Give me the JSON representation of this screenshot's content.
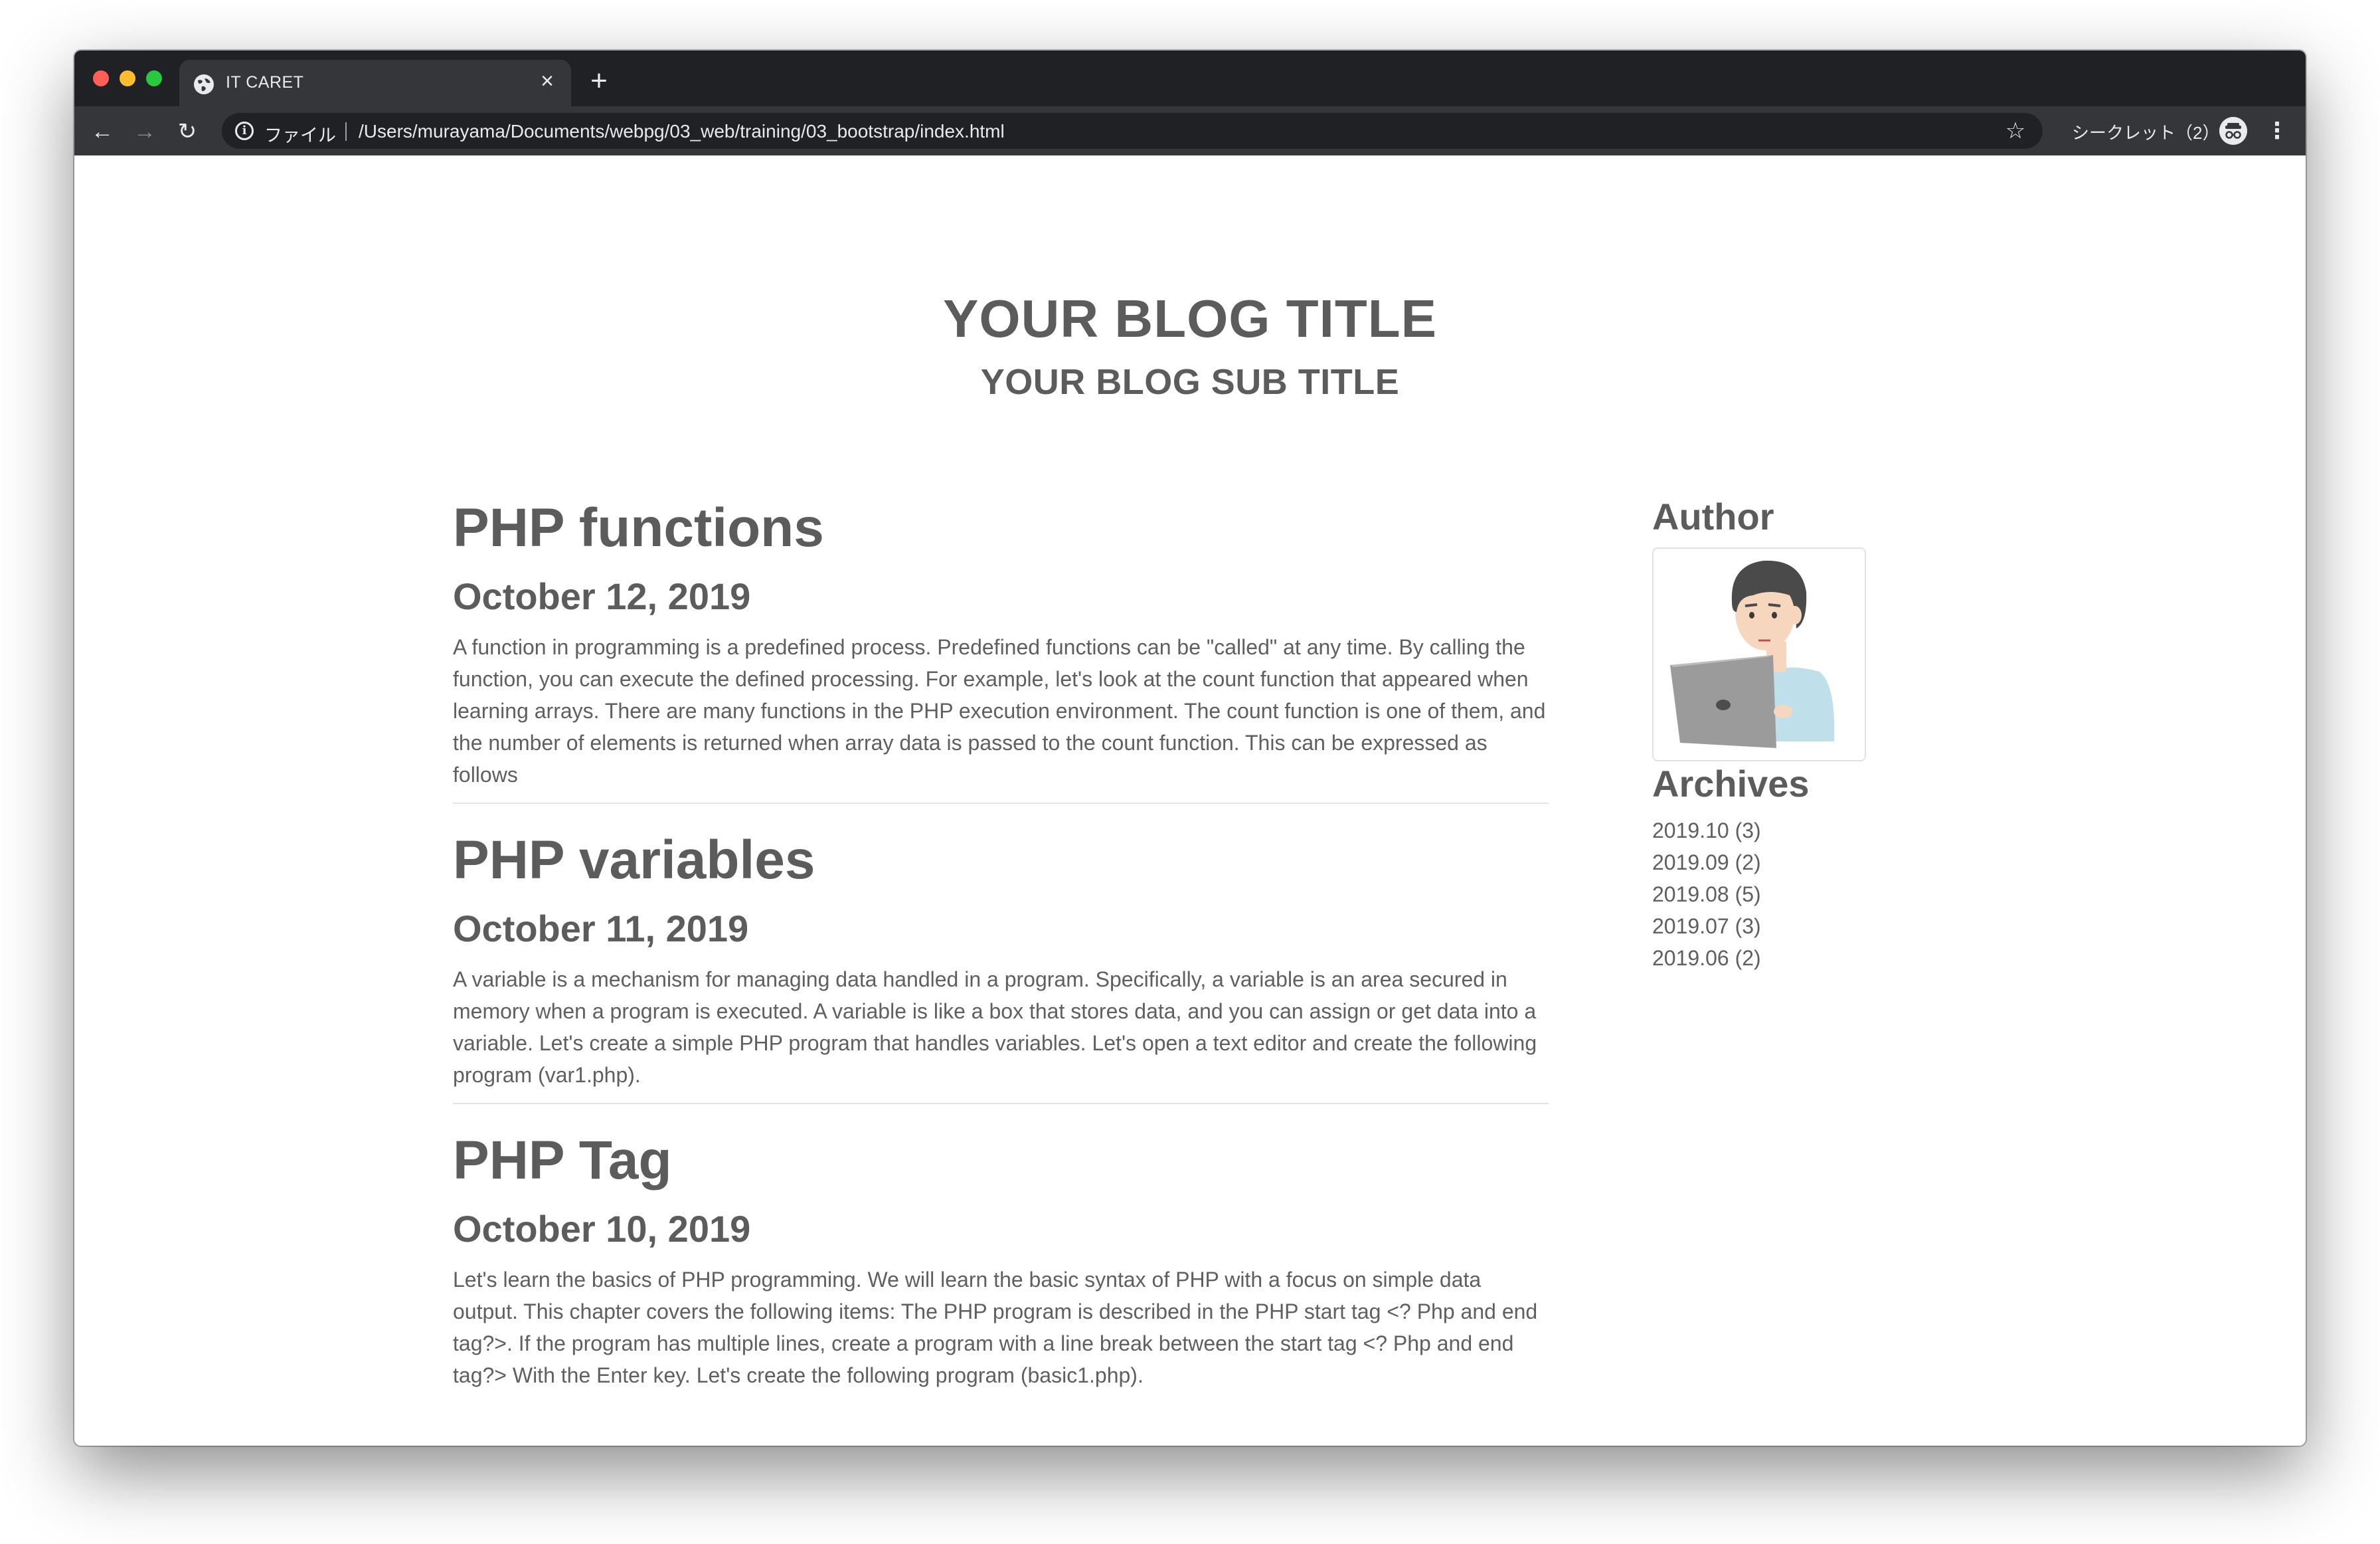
{
  "browser": {
    "tab_title": "IT CARET",
    "tab_close": "×",
    "new_tab": "+",
    "scheme_label": "ファイル",
    "url": "/Users/murayama/Documents/webpg/03_web/training/03_bootstrap/index.html",
    "incognito_label": "シークレット（2）",
    "nav": {
      "back": "←",
      "forward": "→",
      "reload": "↻",
      "star": "☆",
      "menu": "⋮"
    }
  },
  "header": {
    "title": "YOUR BLOG TITLE",
    "subtitle": "YOUR BLOG SUB TITLE"
  },
  "posts": [
    {
      "title": "PHP functions",
      "date": "October 12, 2019",
      "body": "A function in programming is a predefined process. Predefined functions can be \"called\" at any time. By calling the function, you can execute the defined processing. For example, let's look at the count function that appeared when learning arrays. There are many functions in the PHP execution environment. The count function is one of them, and the number of elements is returned when array data is passed to the count function. This can be expressed as follows"
    },
    {
      "title": "PHP variables",
      "date": "October 11, 2019",
      "body": "A variable is a mechanism for managing data handled in a program. Specifically, a variable is an area secured in memory when a program is executed. A variable is like a box that stores data, and you can assign or get data into a variable. Let's create a simple PHP program that handles variables. Let's open a text editor and create the following program (var1.php)."
    },
    {
      "title": "PHP Tag",
      "date": "October 10, 2019",
      "body": "Let's learn the basics of PHP programming. We will learn the basic syntax of PHP with a focus on simple data output. This chapter covers the following items: The PHP program is described in the PHP start tag <? Php and end tag?>. If the program has multiple lines, create a program with a line break between the start tag <? Php and end tag?> With the Enter key. Let's create the following program (basic1.php)."
    }
  ],
  "sidebar": {
    "author_heading": "Author",
    "archives_heading": "Archives",
    "archives": [
      "2019.10 (3)",
      "2019.09 (2)",
      "2019.08 (5)",
      "2019.07 (3)",
      "2019.06 (2)"
    ]
  }
}
